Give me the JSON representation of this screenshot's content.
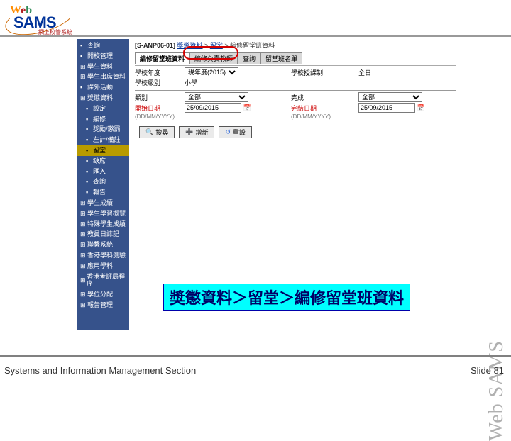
{
  "logo": {
    "web": "Web",
    "sams": "SAMS",
    "sub": "網上校管系統"
  },
  "sidebar": {
    "groups": [
      {
        "label": "查詢",
        "type": "bullet"
      },
      {
        "label": "開校管理",
        "type": "bullet"
      },
      {
        "label": "學生資料",
        "type": "plus"
      },
      {
        "label": "學生出席資料",
        "type": "plus"
      },
      {
        "label": "課外活動",
        "type": "bullet"
      },
      {
        "label": "獎懲資料",
        "type": "plus",
        "expanded": true,
        "children": [
          {
            "label": "設定"
          },
          {
            "label": "編修"
          },
          {
            "label": "獎勵/懲罰"
          },
          {
            "label": "左計/備註"
          },
          {
            "label": "留堂",
            "active": true
          },
          {
            "label": "缺席"
          },
          {
            "label": "匯入"
          },
          {
            "label": "查詢"
          },
          {
            "label": "報告"
          }
        ]
      },
      {
        "label": "學生成績",
        "type": "plus"
      },
      {
        "label": "學生學習概覽",
        "type": "plus"
      },
      {
        "label": "特殊學生成績",
        "type": "plus"
      },
      {
        "label": "教員日誌記",
        "type": "plus"
      },
      {
        "label": "聯繫系統",
        "type": "plus"
      },
      {
        "label": "香港學科測驗",
        "type": "plus"
      },
      {
        "label": "應用學科",
        "type": "plus"
      },
      {
        "label": "香港考評局程序",
        "type": "plus"
      },
      {
        "label": "學位分配",
        "type": "plus"
      },
      {
        "label": "報告管理",
        "type": "plus"
      }
    ]
  },
  "breadcrumb": {
    "code": "[S-ANP06-01]",
    "parts": [
      "獎懲資料",
      "留堂",
      "編修留堂班資料"
    ]
  },
  "tabs": [
    {
      "label": "編修留堂班資料",
      "active": true
    },
    {
      "label": "編修負責教師"
    },
    {
      "label": "查詢"
    },
    {
      "label": "留堂班名單"
    }
  ],
  "form": {
    "school_year_label": "學校年度",
    "school_year_value": "現年度(2015)",
    "school_level_label": "學校級別",
    "school_level_value": "小學",
    "school_session_label": "學校授課制",
    "school_session_value": "全日",
    "class_code_label": "類別",
    "class_code_value": "全部",
    "completion_status_label": "完成",
    "completion_status_value": "全部",
    "start_date_label": "開始日期",
    "start_date_fmt": "(DD/MM/YYYY)",
    "start_date_value": "25/09/2015",
    "end_date_label": "完結日期",
    "end_date_fmt": "(DD/MM/YYYY)",
    "end_date_value": "25/09/2015"
  },
  "buttons": {
    "search": "搜尋",
    "add": "增新",
    "reset": "重設"
  },
  "callout": "獎懲資料＞留堂＞編修留堂班資料",
  "footer": {
    "left": "Systems and Information Management Section",
    "right_prefix": "Slide ",
    "right_num": "81"
  },
  "watermark": "Web SAMS"
}
